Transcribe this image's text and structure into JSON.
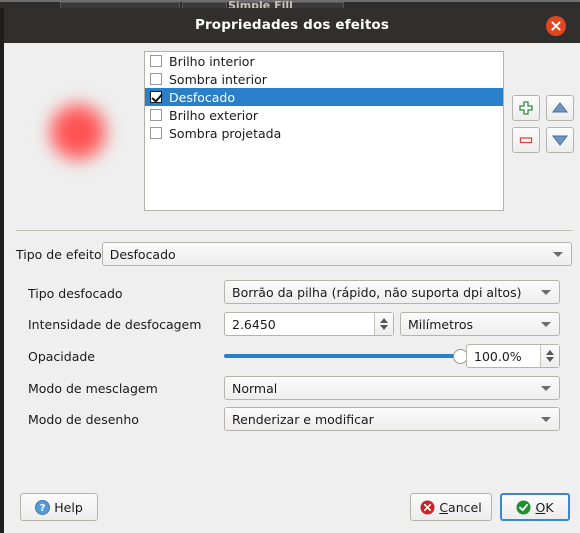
{
  "background_app": {
    "visible_text": "Simple Fill"
  },
  "dialog": {
    "title": "Propriedades dos efeitos",
    "close_icon": "close-icon",
    "colors": {
      "titlebar": "#302f2e",
      "close_button": "#e2461f",
      "selection": "#2a7fc9",
      "slider_fill": "#2a7fc9",
      "face": "#efefef",
      "preview_blob": "#ff4c4c"
    }
  },
  "preview": {
    "shape": "blurred-red-circle"
  },
  "effects_list": {
    "items": [
      {
        "label": "Brilho interior",
        "checked": false,
        "selected": false
      },
      {
        "label": "Sombra interior",
        "checked": false,
        "selected": false
      },
      {
        "label": "Desfocado",
        "checked": true,
        "selected": true
      },
      {
        "label": "Brilho exterior",
        "checked": false,
        "selected": false
      },
      {
        "label": "Sombra projetada",
        "checked": false,
        "selected": false
      }
    ]
  },
  "list_buttons": {
    "add": {
      "icon": "plus-icon",
      "color": "#2e8b3d"
    },
    "remove": {
      "icon": "minus-icon",
      "color": "#d9453c"
    },
    "move_up": {
      "icon": "arrow-up-icon",
      "color": "#5b86b5"
    },
    "move_down": {
      "icon": "arrow-down-icon",
      "color": "#5b86b5"
    }
  },
  "effect_type": {
    "label": "Tipo de efeito",
    "value": "Desfocado"
  },
  "fields": {
    "blur_type": {
      "label": "Tipo desfocado",
      "value": "Borrão da pilha (rápido, não suporta dpi altos)"
    },
    "blur_strength": {
      "label": "Intensidade de desfocagem",
      "value": "2.6450",
      "unit": "Milímetros"
    },
    "opacity": {
      "label": "Opacidade",
      "value": "100.0%",
      "percent": 100
    },
    "blend_mode": {
      "label": "Modo de mesclagem",
      "value": "Normal"
    },
    "draw_mode": {
      "label": "Modo de desenho",
      "value": "Renderizar e modificar"
    }
  },
  "buttons": {
    "help": {
      "label": "Help",
      "icon": "help-icon"
    },
    "cancel": {
      "label": "Cancel",
      "icon": "cancel-icon"
    },
    "ok": {
      "label": "OK",
      "icon": "ok-icon"
    }
  }
}
